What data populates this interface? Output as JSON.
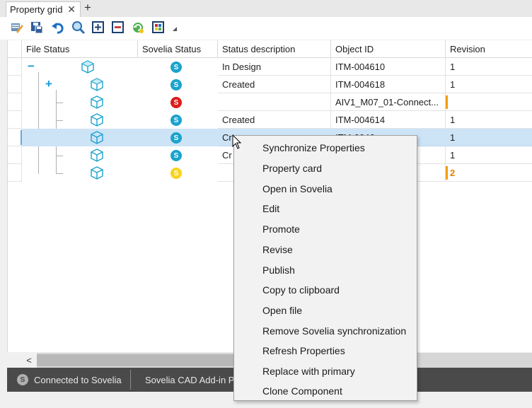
{
  "tab": {
    "title": "Property grid",
    "close": "✕",
    "new": "+"
  },
  "toolbar": {
    "buttons": [
      "edit-icon",
      "save-icon",
      "undo-icon",
      "search-icon",
      "expand-icon",
      "collapse-icon",
      "refresh-icon",
      "grid-settings-icon"
    ]
  },
  "grid": {
    "columns": [
      "File Status",
      "Sovelia Status",
      "Status description",
      "Object ID",
      "Revision"
    ],
    "rows": [
      {
        "expander": "−",
        "status": "blue",
        "status_letter": "S",
        "description": "In Design",
        "object_id": "ITM-004610",
        "revision": "1"
      },
      {
        "expander": "+",
        "status": "blue",
        "status_letter": "S",
        "description": "Created",
        "object_id": "ITM-004618",
        "revision": "1"
      },
      {
        "expander": "",
        "status": "red",
        "status_letter": "S",
        "description": "",
        "object_id": "AIV1_M07_01-Connect...",
        "revision": ""
      },
      {
        "expander": "",
        "status": "blue",
        "status_letter": "S",
        "description": "Created",
        "object_id": "ITM-004614",
        "revision": "1"
      },
      {
        "expander": "",
        "status": "blue",
        "status_letter": "S",
        "description": "Cr",
        "object_id": "ITM-0046",
        "revision": "1"
      },
      {
        "expander": "",
        "status": "blue",
        "status_letter": "S",
        "description": "Cr",
        "object_id": "",
        "revision": "1"
      },
      {
        "expander": "",
        "status": "yellow",
        "status_letter": "S",
        "description": "",
        "object_id": "",
        "revision": "2"
      }
    ]
  },
  "colors": {
    "blue": "#1aa3cc",
    "red": "#e01b1b",
    "yellow": "#f7d31c",
    "accent": "#1a9bd7",
    "orange": "#f39c12",
    "selection": "#cde3f6"
  },
  "scrollbar": {
    "left_arrow": "<"
  },
  "statusbar": {
    "connection_icon": "S",
    "connection": "Connected to Sovelia",
    "addin": "Sovelia CAD Add-in P"
  },
  "context_menu": {
    "items": [
      "Synchronize Properties",
      "Property card",
      "Open in Sovelia",
      "Edit",
      "Promote",
      "Revise",
      "Publish",
      "Copy to clipboard",
      "Open file",
      "Remove Sovelia synchronization",
      "Refresh Properties",
      "Replace with primary",
      "Clone Component"
    ]
  }
}
